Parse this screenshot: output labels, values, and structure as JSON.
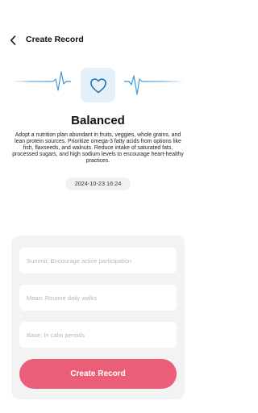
{
  "header": {
    "title": "Create Record",
    "back_icon": "chevron-left-icon"
  },
  "result": {
    "icon": "heart-icon",
    "title": "Balanced",
    "description": "Adopt a nutrition plan abundant in fruits, veggies, whole grains, and lean protein sources. Prioritize omega-3 fatty acids from options like fish, flaxseeds, and walnuts. Reduce intake of saturated fats, processed sugars, and high sodium levels to encourage heart-healthy practices.",
    "timestamp": "2024-10-23 16:24"
  },
  "form": {
    "summit": {
      "value": "",
      "placeholder": "Summit: Encourage active participation"
    },
    "mean": {
      "value": "",
      "placeholder": "Mean: Routine daily walks"
    },
    "base": {
      "value": "",
      "placeholder": "Base: In calm periods"
    },
    "submit_label": "Create Record"
  },
  "colors": {
    "accent": "#eb5e79",
    "pulse_line": "#2d8fd6",
    "icon_bg": "#e4f1fb",
    "panel_bg": "#f3f3f3"
  }
}
